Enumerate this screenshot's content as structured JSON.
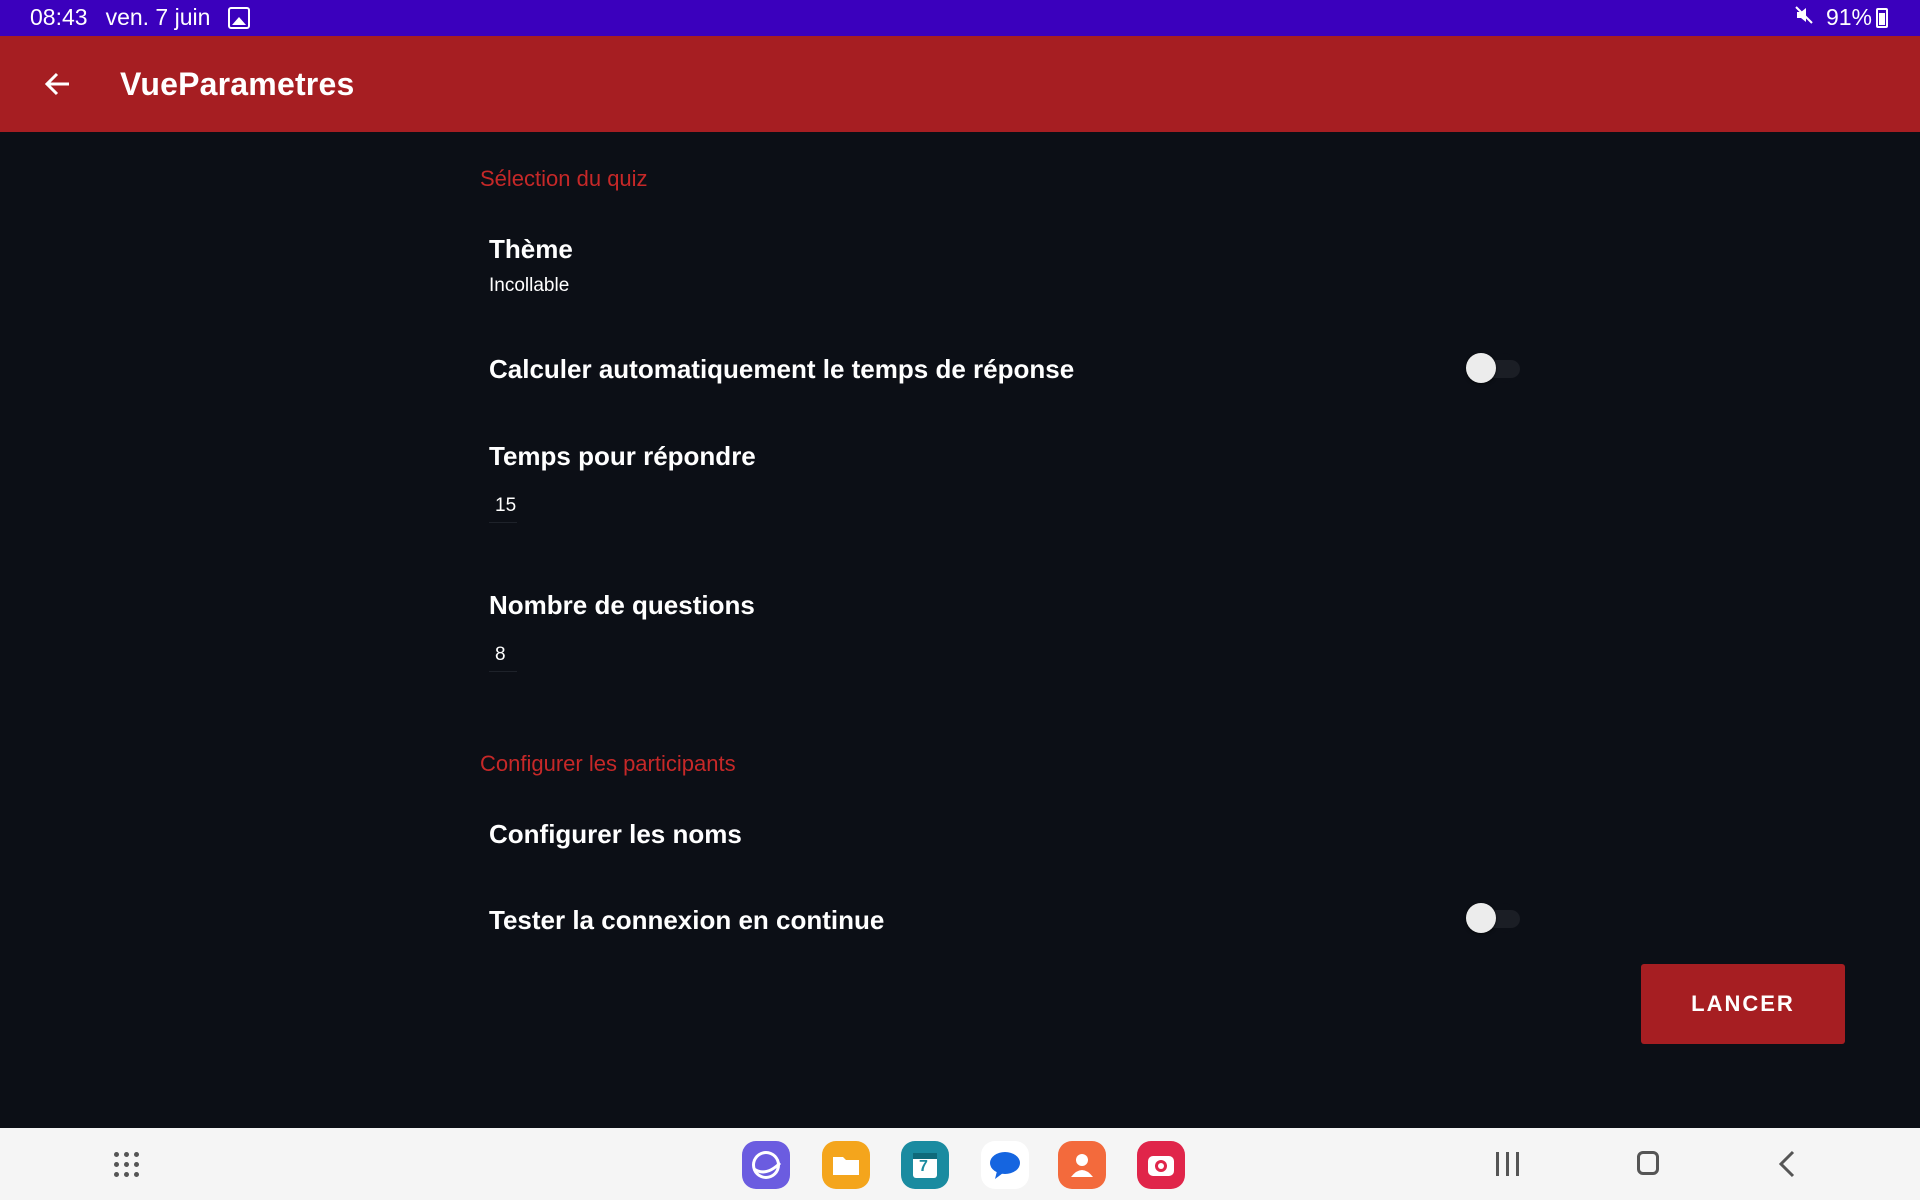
{
  "status_bar": {
    "time": "08:43",
    "date": "ven. 7 juin",
    "battery": "91%"
  },
  "app_bar": {
    "title": "VueParametres",
    "color": "#a61e22"
  },
  "sections": {
    "quiz_header": "Sélection du quiz",
    "participants_header": "Configurer les participants"
  },
  "preferences": {
    "theme_title": "Thème",
    "theme_value": "Incollable",
    "auto_time_label": "Calculer automatiquement le temps de réponse",
    "auto_time_enabled": false,
    "answer_time_label": "Temps pour répondre",
    "answer_time_value": "15",
    "question_count_label": "Nombre de questions",
    "question_count_value": "8",
    "configure_names_label": "Configurer les noms",
    "continuous_test_label": "Tester la connexion en continue",
    "continuous_test_enabled": false
  },
  "actions": {
    "launch_label": "LANCER"
  },
  "dock": {
    "apps": [
      "internet-icon",
      "files-icon",
      "calendar-icon",
      "messages-icon",
      "contacts-icon",
      "camera-icon"
    ],
    "calendar_day": "7"
  },
  "colors": {
    "background": "#0c0f16",
    "accent": "#c62828",
    "status_bar": "#3b00bd"
  }
}
